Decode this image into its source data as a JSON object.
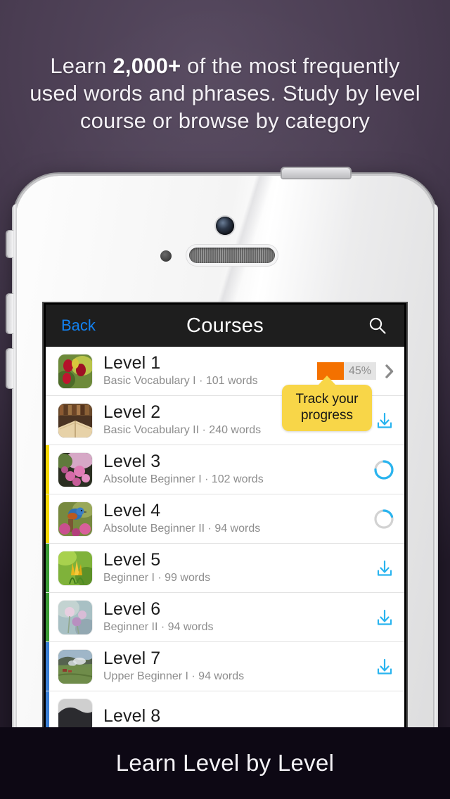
{
  "headline": {
    "line1_pre": "Learn ",
    "line1_bold": "2,000+",
    "line1_post": " of the most frequently",
    "line2": "used words and phrases. Study by level",
    "line3": "course or browse by category"
  },
  "footer": {
    "caption": "Learn Level by Level"
  },
  "navbar": {
    "back_label": "Back",
    "title": "Courses",
    "search_icon": "search-icon"
  },
  "colors": {
    "accent_blue": "#1282f2",
    "progress_orange": "#f47100",
    "progress_track": "#e4e4e4",
    "download_cyan": "#29b4ef",
    "tooltip_yellow": "#f8d648",
    "strip_yellow": "#f5d800",
    "strip_green": "#3a9a35",
    "strip_blue": "#3b7fd4",
    "navbar_bg": "#1e1e1e",
    "footer_bg": "#0d0814"
  },
  "tooltip": {
    "line1": "Track your",
    "line2": "progress"
  },
  "courses": [
    {
      "title": "Level 1",
      "subtitle": "Basic Vocabulary I · 101 words",
      "thumb": "red-tulips-photo",
      "strip_color": "none",
      "status": "progress",
      "progress_pct": 45,
      "progress_label": "45%",
      "accessory": "chevron-right-icon"
    },
    {
      "title": "Level 2",
      "subtitle": "Basic Vocabulary II · 240 words",
      "thumb": "open-books-photo",
      "strip_color": "none",
      "status": "download",
      "accessory": "download-icon"
    },
    {
      "title": "Level 3",
      "subtitle": "Absolute Beginner I · 102 words",
      "thumb": "pink-blossoms-photo",
      "strip_color": "#f5d800",
      "status": "downloading",
      "ring_pct": 75,
      "accessory": "progress-ring-icon"
    },
    {
      "title": "Level 4",
      "subtitle": "Absolute Beginner II · 94 words",
      "thumb": "bluebird-photo",
      "strip_color": "#f5d800",
      "status": "downloading",
      "ring_pct": 20,
      "accessory": "progress-ring-icon"
    },
    {
      "title": "Level 5",
      "subtitle": "Beginner I · 99 words",
      "thumb": "yellow-crocus-photo",
      "strip_color": "#3a9a35",
      "status": "download",
      "accessory": "download-icon"
    },
    {
      "title": "Level 6",
      "subtitle": "Beginner II · 94 words",
      "thumb": "pink-soft-flowers-photo",
      "strip_color": "#3a9a35",
      "status": "download",
      "accessory": "download-icon"
    },
    {
      "title": "Level 7",
      "subtitle": "Upper Beginner I · 94 words",
      "thumb": "steam-landscape-photo",
      "strip_color": "#3b7fd4",
      "status": "download",
      "accessory": "download-icon"
    },
    {
      "title": "Level 8",
      "subtitle": "",
      "thumb": "dark-landscape-photo",
      "strip_color": "#3b7fd4",
      "status": "clipped",
      "accessory": ""
    }
  ]
}
